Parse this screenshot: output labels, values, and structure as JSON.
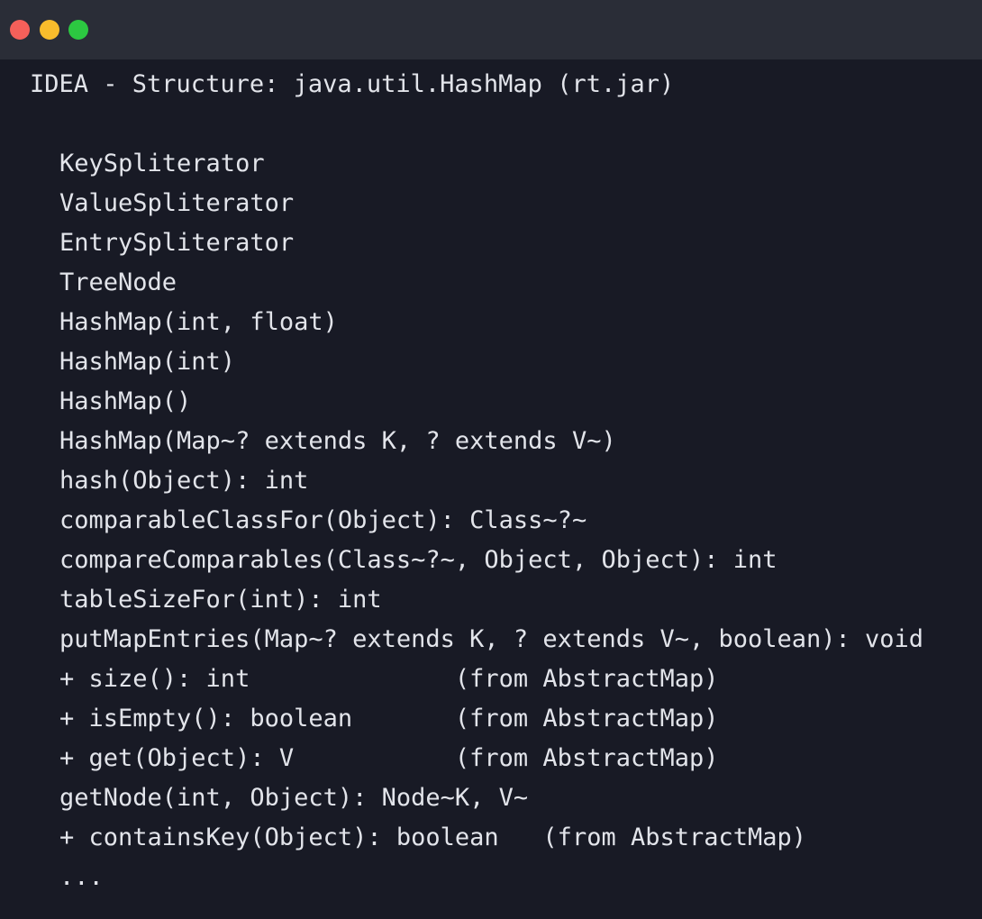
{
  "window": {
    "controls": {
      "close_color": "#f5605a",
      "minimize_color": "#f8bc2c",
      "maximize_color": "#2cc841"
    }
  },
  "header": {
    "title": "IDEA - Structure: java.util.HashMap (rt.jar)"
  },
  "structure": {
    "items": [
      "KeySpliterator",
      "ValueSpliterator",
      "EntrySpliterator",
      "TreeNode",
      "HashMap(int, float)",
      "HashMap(int)",
      "HashMap()",
      "HashMap(Map~? extends K, ? extends V~)",
      "hash(Object): int",
      "comparableClassFor(Object): Class~?~",
      "compareComparables(Class~?~, Object, Object): int",
      "tableSizeFor(int): int",
      "putMapEntries(Map~? extends K, ? extends V~, boolean): void",
      "+ size(): int              (from AbstractMap)",
      "+ isEmpty(): boolean       (from AbstractMap)",
      "+ get(Object): V           (from AbstractMap)",
      "getNode(int, Object): Node~K, V~",
      "+ containsKey(Object): boolean   (from AbstractMap)",
      "..."
    ]
  }
}
